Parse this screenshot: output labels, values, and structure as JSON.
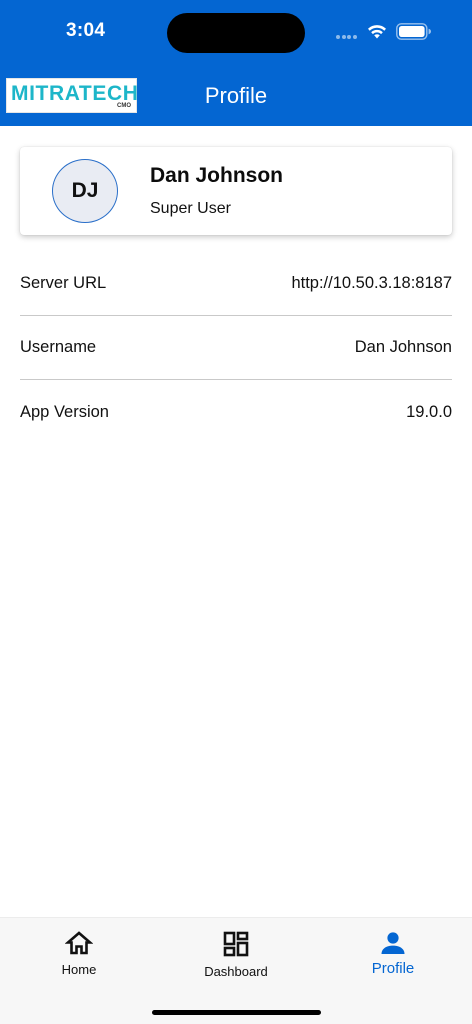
{
  "status_bar": {
    "time": "3:04"
  },
  "header": {
    "logo_text": "MITRATECH",
    "logo_sub": "CMO",
    "title": "Profile",
    "color": "#0466d2"
  },
  "profile": {
    "initials": "DJ",
    "name": "Dan Johnson",
    "role": "Super User"
  },
  "info": [
    {
      "label": "Server URL",
      "value": "http://10.50.3.18:8187"
    },
    {
      "label": "Username",
      "value": "Dan Johnson"
    },
    {
      "label": "App Version",
      "value": "19.0.0"
    }
  ],
  "tabs": [
    {
      "label": "Home",
      "icon": "home-icon",
      "active": false
    },
    {
      "label": "Dashboard",
      "icon": "dashboard-icon",
      "active": false
    },
    {
      "label": "Profile",
      "icon": "person-icon",
      "active": true
    }
  ],
  "accent": "#0466d2"
}
